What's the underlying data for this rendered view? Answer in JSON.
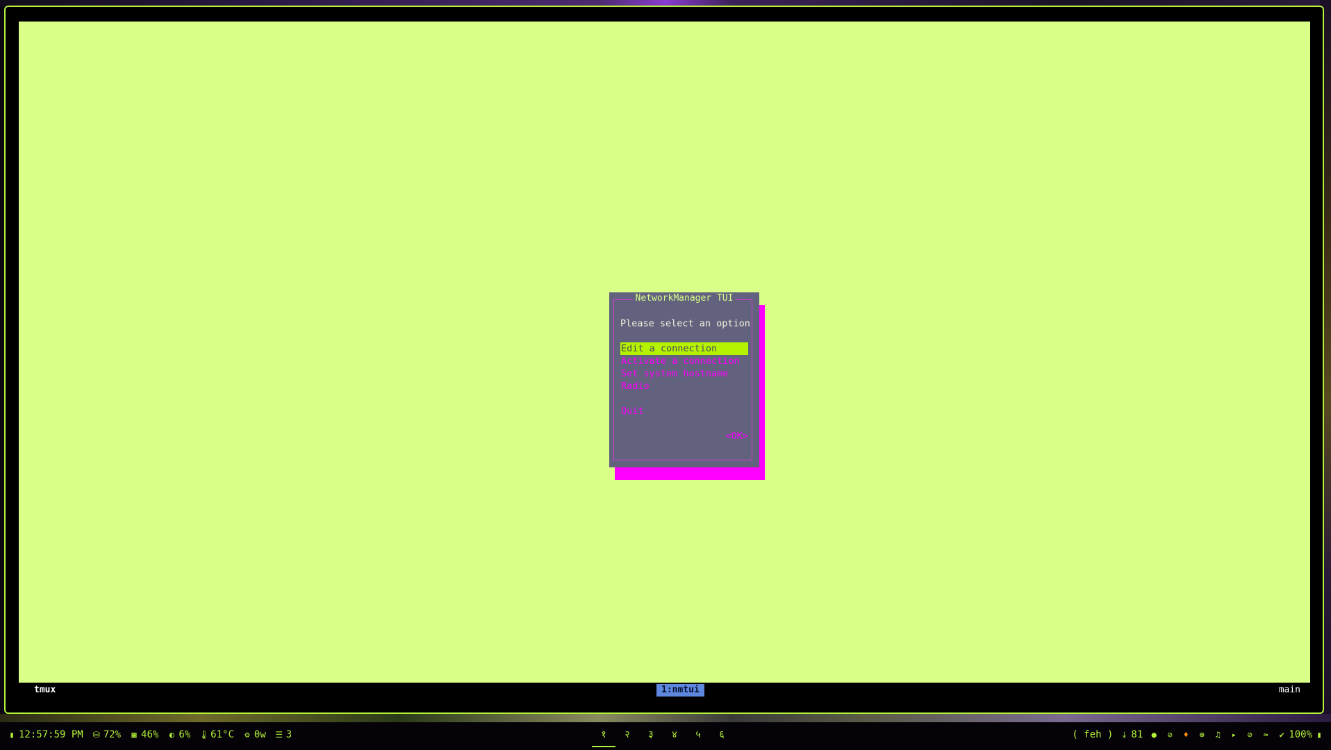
{
  "dialog": {
    "title": "NetworkManager TUI",
    "prompt": "Please select an option",
    "menu_items": [
      {
        "label": "Edit a connection",
        "selected": true
      },
      {
        "label": "Activate a connection",
        "selected": false
      },
      {
        "label": "Set system hostname",
        "selected": false
      },
      {
        "label": "Radio",
        "selected": false
      },
      {
        "label": "Quit",
        "selected": false
      }
    ],
    "ok_label": "<OK>"
  },
  "tmux": {
    "session_label": "tmux",
    "window_label": "1:nmtui",
    "session_name": "main"
  },
  "sysbar": {
    "time": "12:57:59 PM",
    "disk": "72%",
    "memory": "46%",
    "cpu": "6%",
    "temperature": "61°C",
    "power": "0w",
    "count": "3",
    "workspaces": [
      "१",
      "२",
      "३",
      "४",
      "५",
      "६"
    ],
    "active_workspace": 0,
    "active_app": "( feh )",
    "updates": "81",
    "battery": "100%"
  },
  "colors": {
    "terminal_bg": "#d9ff88",
    "accent": "#b5f23a",
    "dialog_bg": "#62627e",
    "dialog_shadow": "#ff00ff",
    "menu_text": "#ff00ff",
    "selection_bg": "#b5f200",
    "tmux_window_bg": "#5e87e0"
  }
}
